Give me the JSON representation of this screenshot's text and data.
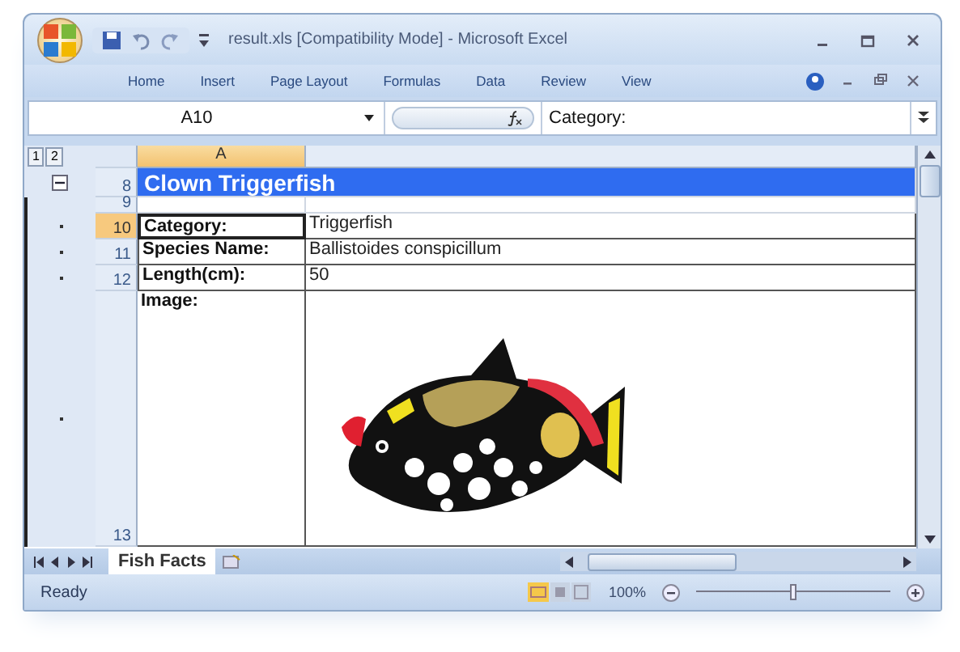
{
  "window": {
    "title": "result.xls  [Compatibility Mode] - Microsoft Excel"
  },
  "ribbon_tabs": [
    {
      "label": "Home",
      "selected": false
    },
    {
      "label": "Insert",
      "selected": false
    },
    {
      "label": "Page Layout",
      "selected": false
    },
    {
      "label": "Formulas",
      "selected": false
    },
    {
      "label": "Data",
      "selected": false
    },
    {
      "label": "Review",
      "selected": false
    },
    {
      "label": "View",
      "selected": false
    }
  ],
  "formula_bar": {
    "name_box": "A10",
    "formula": "Category:"
  },
  "outline_levels": [
    "1",
    "2"
  ],
  "columns": [
    "A"
  ],
  "rows": [
    {
      "number": "8",
      "kind": "title",
      "collapsible": true,
      "grouped": false,
      "selected": false,
      "cells": [
        "Clown Triggerfish"
      ]
    },
    {
      "number": "9",
      "kind": "blank",
      "collapsible": false,
      "grouped": false,
      "selected": false
    },
    {
      "number": "10",
      "kind": "field",
      "collapsible": false,
      "grouped": true,
      "selected": true,
      "cells": [
        "Category:",
        "Triggerfish"
      ]
    },
    {
      "number": "11",
      "kind": "field",
      "collapsible": false,
      "grouped": true,
      "selected": false,
      "cells": [
        "Species Name:",
        "Ballistoides conspicillum"
      ]
    },
    {
      "number": "12",
      "kind": "field",
      "collapsible": false,
      "grouped": true,
      "selected": false,
      "cells": [
        "Length(cm):",
        "50"
      ]
    },
    {
      "number": "13",
      "kind": "image",
      "collapsible": false,
      "grouped": true,
      "selected": false,
      "cells": [
        "Image:"
      ]
    }
  ],
  "sheet_tabs": [
    {
      "label": "Fish Facts",
      "selected": true
    }
  ],
  "status_bar": {
    "status": "Ready",
    "zoom": "100%",
    "zoom_level": {
      "level": 0.5
    }
  }
}
